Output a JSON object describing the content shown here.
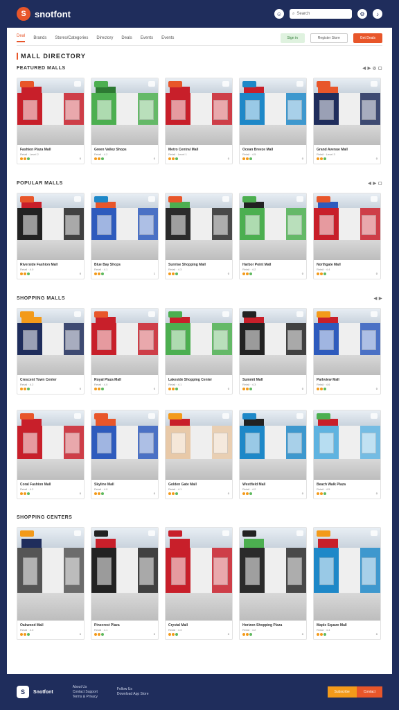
{
  "header": {
    "brand": "snotfont",
    "logo_letter": "S",
    "search_placeholder": "Search"
  },
  "nav": {
    "tabs": [
      "Deal",
      "Brands",
      "Stores/Categories",
      "Directory",
      "Deals",
      "Events",
      "Events"
    ],
    "buttons": [
      "Sign in",
      "Register Store",
      "Get Deals"
    ]
  },
  "page_title": "MALL DIRECTORY",
  "sections": [
    {
      "title": "FEATURED MALLS",
      "control": "◀ ▶ ◎ ▢",
      "rows": [
        [
          {
            "title": "Fashion Plaza Mall",
            "sub": "Retail · Level 2",
            "count": "0",
            "tag": "",
            "tagColor": "#e8562a",
            "wall": "#c81f2a",
            "stripe": "#c81f2a"
          },
          {
            "title": "Green Valley Shops",
            "sub": "Retail · 4.2",
            "count": "0",
            "tag": "",
            "tagColor": "#4caf50",
            "wall": "#4caf50",
            "stripe": "#2d7a33"
          },
          {
            "title": "Metro Central Mall",
            "sub": "Retail · Level 1",
            "count": "0",
            "tag": "",
            "tagColor": "#e8562a",
            "wall": "#c81f2a",
            "stripe": "#c81f2a"
          },
          {
            "title": "Ocean Breeze Mall",
            "sub": "Retail · 4.5",
            "count": "0",
            "tag": "",
            "tagColor": "#1e88c8",
            "wall": "#1e88c8",
            "stripe": "#c81f2a"
          },
          {
            "title": "Grand Avenue Mall",
            "sub": "Retail · Level 3",
            "count": "0",
            "tag": "",
            "tagColor": "#e8562a",
            "wall": "#1f2d5c",
            "stripe": "#e8562a"
          }
        ]
      ]
    },
    {
      "title": "POPULAR MALLS",
      "control": "◀ ▶ ▢",
      "rows": [
        [
          {
            "title": "Riverside Fashion Mall",
            "sub": "Retail · 4.0",
            "count": "0",
            "tag": "",
            "tagColor": "#e8562a",
            "wall": "#222",
            "stripe": "#c81f2a"
          },
          {
            "title": "Blue Bay Shops",
            "sub": "Retail · 4.1",
            "count": "1",
            "tag": "",
            "tagColor": "#1e88c8",
            "wall": "#2e5bbd",
            "stripe": "#e8562a"
          },
          {
            "title": "Sunrise Shopping Mall",
            "sub": "Retail · 4.3",
            "count": "0",
            "tag": "",
            "tagColor": "#e8562a",
            "wall": "#2b2b2b",
            "stripe": "#4caf50"
          },
          {
            "title": "Harbor Point Mall",
            "sub": "Retail · 4.2",
            "count": "0",
            "tag": "",
            "tagColor": "#4caf50",
            "wall": "#4caf50",
            "stripe": "#222"
          },
          {
            "title": "Northgate Mall",
            "sub": "Retail · 4.4",
            "count": "0",
            "tag": "",
            "tagColor": "#e8562a",
            "wall": "#c81f2a",
            "stripe": "#2e5bbd"
          }
        ]
      ]
    },
    {
      "title": "SHOPPING MALLS",
      "control": "◀ ▶",
      "rows": [
        [
          {
            "title": "Crescent Town Center",
            "sub": "Retail · 4.2",
            "count": "0",
            "tag": "",
            "tagColor": "#f39a1a",
            "wall": "#1f2d5c",
            "stripe": "#f39a1a"
          },
          {
            "title": "Royal Plaza Mall",
            "sub": "Retail · 4.0",
            "count": "0",
            "tag": "",
            "tagColor": "#e8562a",
            "wall": "#c81f2a",
            "stripe": "#c81f2a"
          },
          {
            "title": "Lakeside Shopping Center",
            "sub": "Retail · 4.1",
            "count": "0",
            "tag": "",
            "tagColor": "#4caf50",
            "wall": "#4caf50",
            "stripe": "#c81f2a"
          },
          {
            "title": "Summit Mall",
            "sub": "Retail · 4.3",
            "count": "0",
            "tag": "",
            "tagColor": "#222",
            "wall": "#222",
            "stripe": "#c81f2a"
          },
          {
            "title": "Parkview Mall",
            "sub": "Retail · 4.6",
            "count": "0",
            "tag": "",
            "tagColor": "#f39a1a",
            "wall": "#2e5bbd",
            "stripe": "#c81f2a"
          }
        ],
        [
          {
            "title": "Coral Fashion Mall",
            "sub": "Retail · 4.2",
            "count": "0",
            "tag": "",
            "tagColor": "#e8562a",
            "wall": "#c81f2a",
            "stripe": "#c81f2a"
          },
          {
            "title": "Skyline Mall",
            "sub": "Retail · 4.0",
            "count": "0",
            "tag": "",
            "tagColor": "#e8562a",
            "wall": "#2e5bbd",
            "stripe": "#e8562a"
          },
          {
            "title": "Golden Gate Mall",
            "sub": "Retail · 4.1",
            "count": "0",
            "tag": "",
            "tagColor": "#f39a1a",
            "wall": "#e8c9a8",
            "stripe": "#c81f2a"
          },
          {
            "title": "Westfield Mall",
            "sub": "Retail · 4.2",
            "count": "0",
            "tag": "",
            "tagColor": "#1e88c8",
            "wall": "#1e88c8",
            "stripe": "#222"
          },
          {
            "title": "Beach Walk Plaza",
            "sub": "Retail · 4.5",
            "count": "0",
            "tag": "",
            "tagColor": "#4caf50",
            "wall": "#5fb3e0",
            "stripe": "#c81f2a"
          }
        ]
      ]
    },
    {
      "title": "SHOPPING CENTERS",
      "control": "",
      "rows": [
        [
          {
            "title": "Oakwood Mall",
            "sub": "Retail · 4.0",
            "count": "0",
            "tag": "",
            "tagColor": "#f39a1a",
            "wall": "#555",
            "stripe": "#1f2d5c"
          },
          {
            "title": "Pinecrest Plaza",
            "sub": "Retail · 4.1",
            "count": "0",
            "tag": "",
            "tagColor": "#222",
            "wall": "#222",
            "stripe": "#c81f2a"
          },
          {
            "title": "Crystal Mall",
            "sub": "Retail · 4.3",
            "count": "0",
            "tag": "",
            "tagColor": "#c81f2a",
            "wall": "#c81f2a",
            "stripe": "#c81f2a"
          },
          {
            "title": "Horizon Shopping Plaza",
            "sub": "Retail · 4.2",
            "count": "0",
            "tag": "",
            "tagColor": "#222",
            "wall": "#2b2b2b",
            "stripe": "#4caf50"
          },
          {
            "title": "Maple Square Mall",
            "sub": "Retail · 4.4",
            "count": "0",
            "tag": "",
            "tagColor": "#f39a1a",
            "wall": "#1e88c8",
            "stripe": "#c81f2a"
          }
        ]
      ]
    }
  ],
  "footer": {
    "brand": "Snotfont",
    "logo_letter": "S",
    "col1": [
      "About Us",
      "Contact Support",
      "Terms & Privacy"
    ],
    "col2": [
      "Follow Us",
      "Download App Store"
    ],
    "btn1": "Subscribe",
    "btn2": "Contact"
  },
  "colors": {
    "navy": "#1f2d5c",
    "accent": "#e8562a",
    "orange": "#f39a1a",
    "green": "#4caf50"
  }
}
